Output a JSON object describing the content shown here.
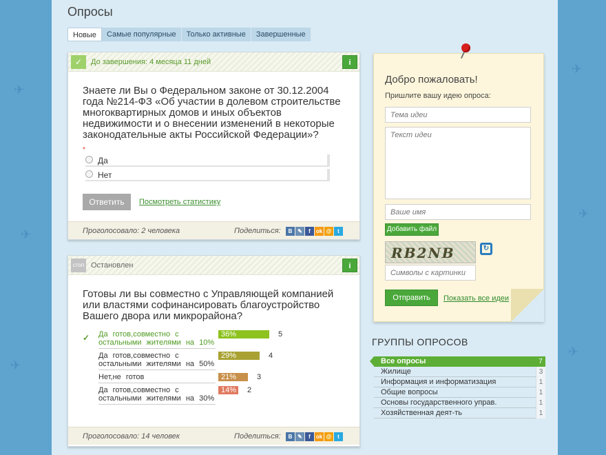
{
  "page": {
    "title": "Опросы"
  },
  "tabs": [
    {
      "label": "Новые",
      "active": true
    },
    {
      "label": "Самые популярные",
      "active": false
    },
    {
      "label": "Только активные",
      "active": false
    },
    {
      "label": "Завершенные",
      "active": false
    }
  ],
  "poll1": {
    "status_text": "До завершения: 4 месяца 11 дней",
    "info_icon": "info-icon",
    "question": "Знаете ли Вы о Федеральном законе от 30.12.2004 года №214-ФЗ «Об участии в долевом строительстве многоквартирных домов и иных объектов недвижимости и о внесении изменений в некоторые законодательные акты Российской Федерации»?",
    "required_mark": "*",
    "options": [
      "Да",
      "Нет"
    ],
    "answer_label": "Ответить",
    "stats_link": "Посмотреть статистику",
    "voted": "Проголосовало: 2 человека",
    "share_label": "Поделиться:"
  },
  "poll2": {
    "status_icon_text": "стоп",
    "status_text": "Остановлен",
    "question": "Готовы ли вы совместно с Управляющей компанией или властями софинансировать благоустройство Вашего двора или микрорайона?",
    "results": [
      {
        "label": "Да готов,совместно с остальными жителями на 10%",
        "percent_label": "36%",
        "percent": 36,
        "count": "5",
        "color": "#8dc21f",
        "selected": true
      },
      {
        "label": "Да готов,совместно с остальными жителями на 50%",
        "percent_label": "29%",
        "percent": 29,
        "count": "4",
        "color": "#a9a232",
        "selected": false
      },
      {
        "label": "Нет,не готов",
        "percent_label": "21%",
        "percent": 21,
        "count": "3",
        "color": "#c8904a",
        "selected": false
      },
      {
        "label": "Да готов,совместно с остальными жителями на 30%",
        "percent_label": "14%",
        "percent": 14,
        "count": "2",
        "color": "#e07a5f",
        "selected": false
      }
    ],
    "voted": "Проголосовало: 14 человек",
    "share_label": "Поделиться:"
  },
  "social": [
    {
      "name": "vk-icon",
      "glyph": "В",
      "color": "#4a76a8"
    },
    {
      "name": "livejournal-icon",
      "glyph": "✎",
      "color": "#6b8fb5"
    },
    {
      "name": "facebook-icon",
      "glyph": "f",
      "color": "#3b5998"
    },
    {
      "name": "odnoklassniki-icon",
      "glyph": "ok",
      "color": "#f59a12"
    },
    {
      "name": "mailru-icon",
      "glyph": "@",
      "color": "#f29f05"
    },
    {
      "name": "twitter-icon",
      "glyph": "t",
      "color": "#2aa9e0"
    }
  ],
  "sidebar_form": {
    "welcome": "Добро пожаловать!",
    "prompt": "Пришлите вашу идею опроса:",
    "topic_placeholder": "Тема идеи",
    "text_placeholder": "Текст идеи",
    "name_placeholder": "Ваше имя",
    "add_file": "Добавить файл",
    "captcha_text": "RB2NB",
    "captcha_placeholder": "Символы с картинки",
    "submit": "Отправить",
    "show_all": "Показать все идеи"
  },
  "groups": {
    "title": "ГРУППЫ ОПРОСОВ",
    "items": [
      {
        "label": "Все опросы",
        "count": "7",
        "active": true
      },
      {
        "label": "Жилище",
        "count": "3",
        "active": false
      },
      {
        "label": "Информация и информатизация",
        "count": "1",
        "active": false
      },
      {
        "label": "Общие вопросы",
        "count": "1",
        "active": false
      },
      {
        "label": "Основы государственного управ.",
        "count": "1",
        "active": false
      },
      {
        "label": "Хозяйственная деят-ть",
        "count": "1",
        "active": false
      }
    ]
  },
  "colors": {
    "accent_green": "#4aa83a",
    "background_blue": "#5fa3cf",
    "panel_blue": "#daebf5"
  }
}
